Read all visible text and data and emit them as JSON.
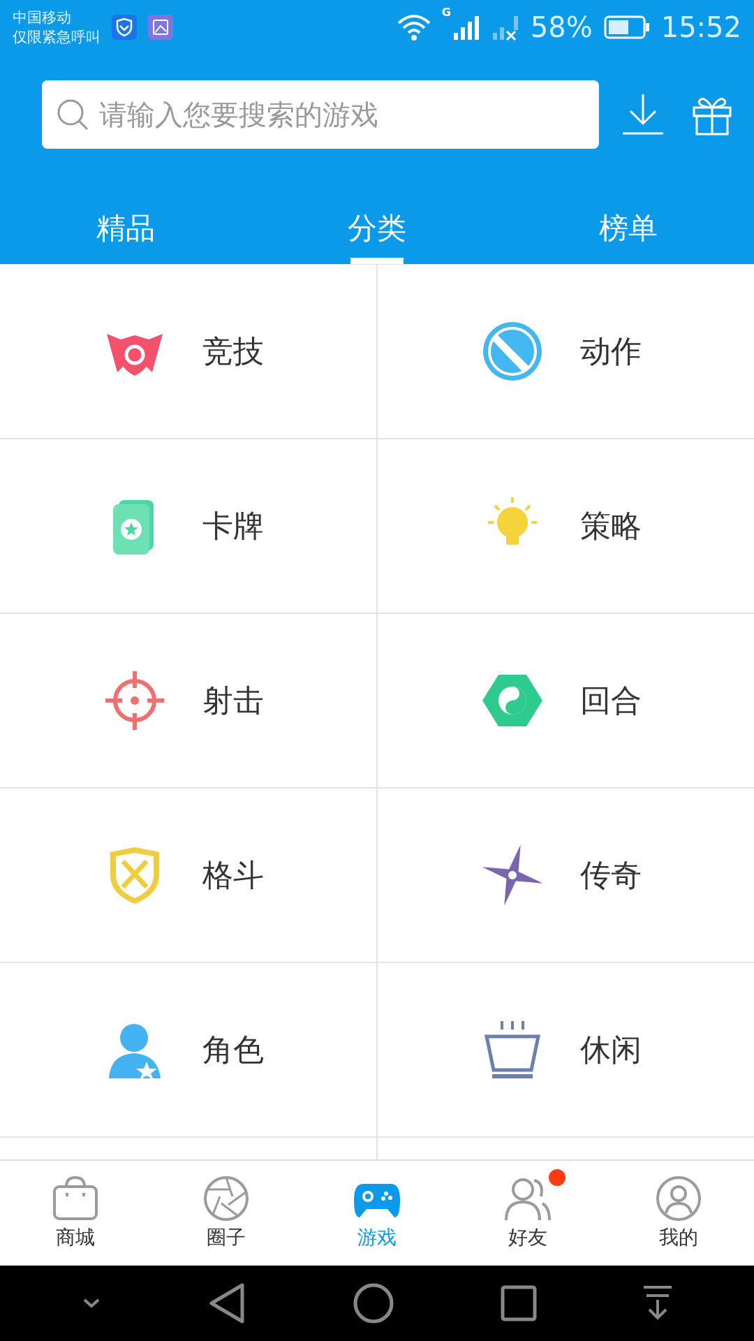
{
  "status_bar": {
    "carrier": "中国移动",
    "carrier_note": "仅限紧急呼叫",
    "battery_percent": "58%",
    "time": "15:52",
    "network_label": "G"
  },
  "search": {
    "placeholder": "请输入您要搜索的游戏"
  },
  "tabs": [
    {
      "label": "精品",
      "selected": false
    },
    {
      "label": "分类",
      "selected": true
    },
    {
      "label": "榜单",
      "selected": false
    }
  ],
  "categories": [
    {
      "label": "竞技",
      "kind": "wings"
    },
    {
      "label": "动作",
      "kind": "blade"
    },
    {
      "label": "卡牌",
      "kind": "card"
    },
    {
      "label": "策略",
      "kind": "bulb"
    },
    {
      "label": "射击",
      "kind": "crosshair"
    },
    {
      "label": "回合",
      "kind": "yinyang"
    },
    {
      "label": "格斗",
      "kind": "shield"
    },
    {
      "label": "传奇",
      "kind": "shuriken"
    },
    {
      "label": "角色",
      "kind": "person"
    },
    {
      "label": "休闲",
      "kind": "bowl"
    }
  ],
  "bottom_nav": [
    {
      "label": "商城",
      "kind": "bag",
      "selected": false,
      "badge": false
    },
    {
      "label": "圈子",
      "kind": "aperture",
      "selected": false,
      "badge": false
    },
    {
      "label": "游戏",
      "kind": "gamepad",
      "selected": true,
      "badge": false
    },
    {
      "label": "好友",
      "kind": "people",
      "selected": false,
      "badge": true
    },
    {
      "label": "我的",
      "kind": "user",
      "selected": false,
      "badge": false
    }
  ]
}
